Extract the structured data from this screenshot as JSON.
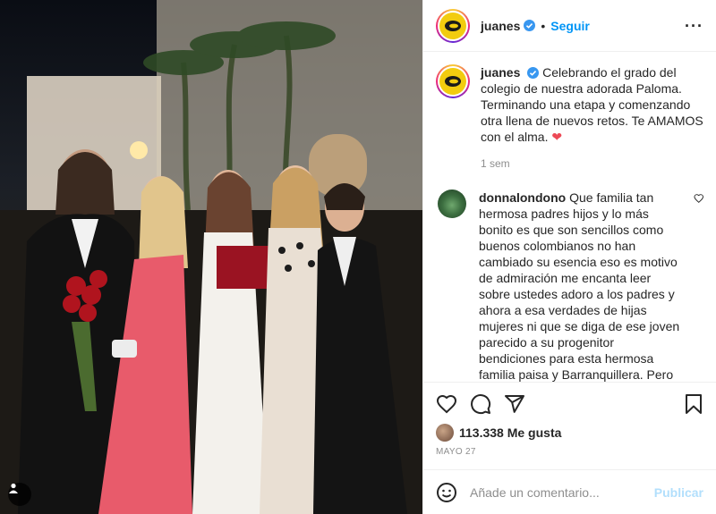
{
  "post": {
    "username": "juanes",
    "follow_label": "Seguir",
    "more_icon": "more-icon",
    "caption": "Celebrando el grado del colegio de nuestra adorada Paloma. Terminando una etapa y comenzando otra llena de nuevos retos. Te AMAMOS con el alma.",
    "caption_emoji": "❤",
    "time_ago": "1 sem"
  },
  "comments": [
    {
      "username": "donnalondono",
      "text": "Que familia tan hermosa padres hijos y lo más bonito es que son sencillos como buenos colombianos no han cambiado su esencia eso es motivo de admiración me encanta leer sobre ustedes adoro a los padres y ahora a esa verdades de hijas mujeres ni que se diga de ese joven parecido a su progenitor bendiciones para esta hermosa familia paisa y Barranquillera. Pero con orgullo colombiano."
    }
  ],
  "actions": {
    "likes": "113.338 Me gusta",
    "date": "MAYO 27"
  },
  "add_comment": {
    "placeholder": "Añade un comentario...",
    "publish_label": "Publicar"
  },
  "colors": {
    "accent": "#0095f6",
    "heart": "#ed4956",
    "logo": "#f2cc0f"
  }
}
